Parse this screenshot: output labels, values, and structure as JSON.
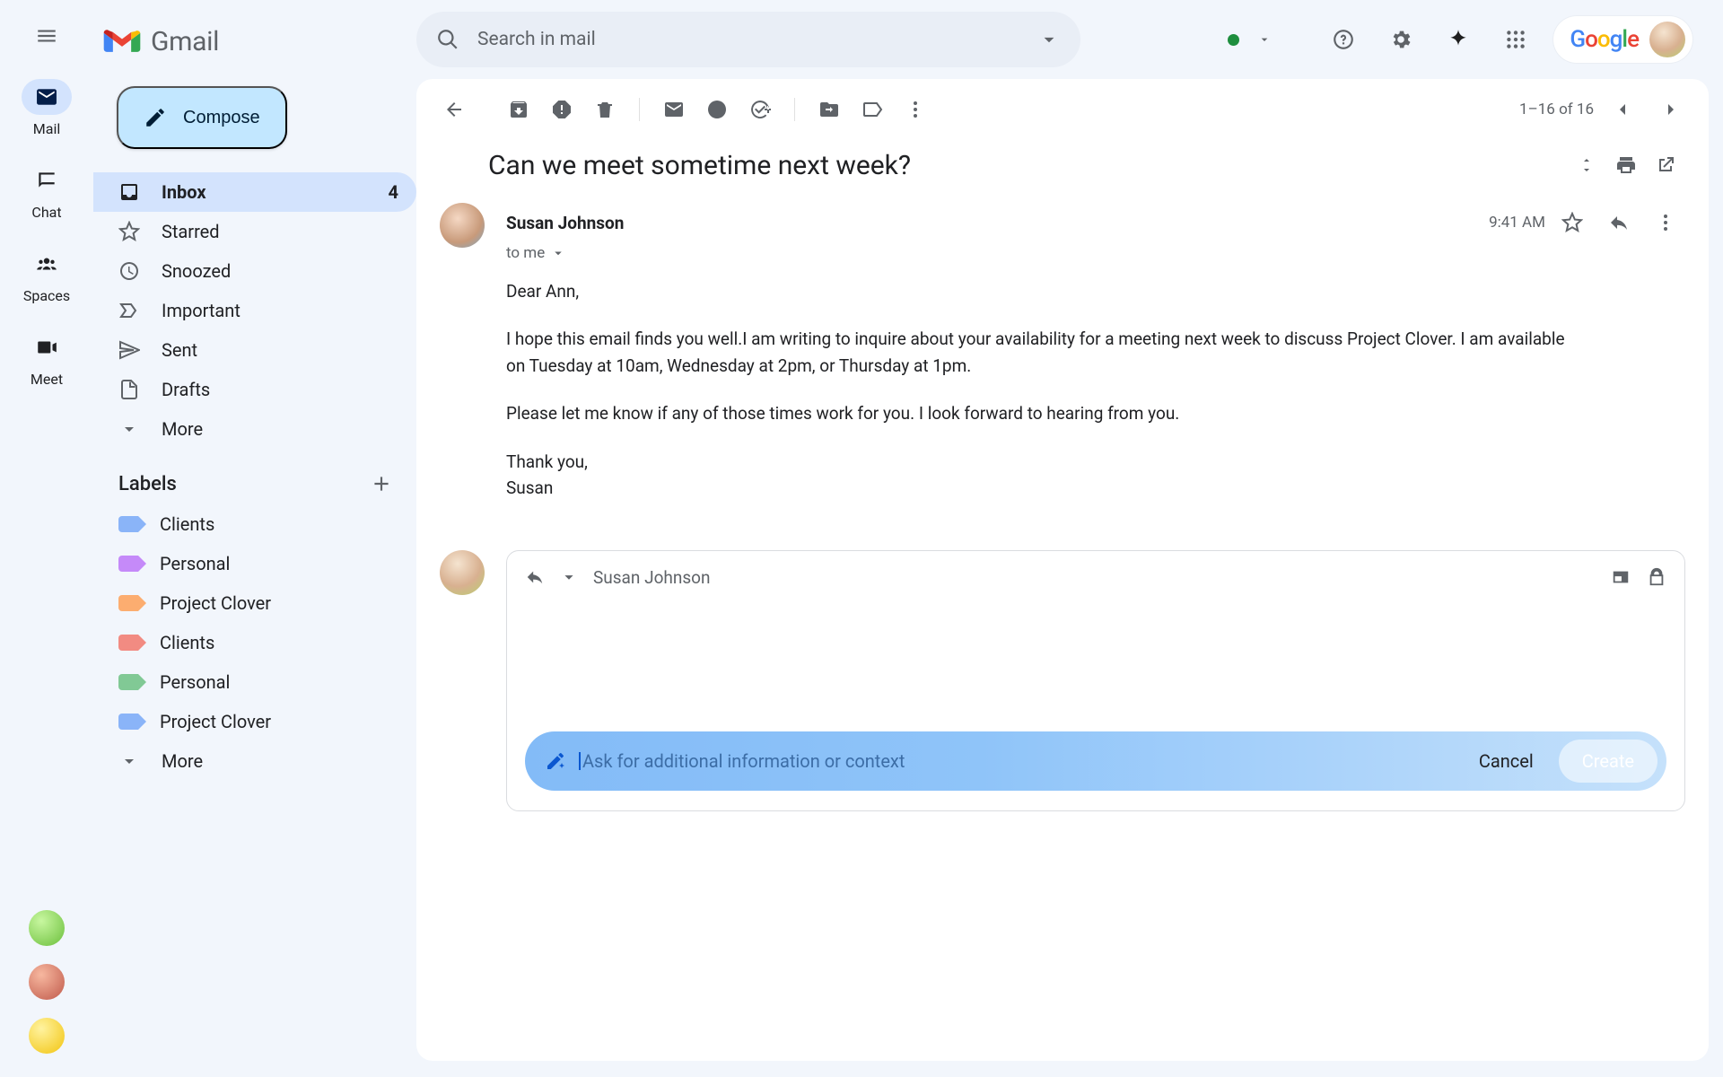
{
  "app": {
    "name": "Gmail"
  },
  "rail": {
    "items": [
      {
        "id": "mail",
        "label": "Mail",
        "active": true
      },
      {
        "id": "chat",
        "label": "Chat",
        "active": false
      },
      {
        "id": "spaces",
        "label": "Spaces",
        "active": false
      },
      {
        "id": "meet",
        "label": "Meet",
        "active": false
      }
    ]
  },
  "search": {
    "placeholder": "Search in mail"
  },
  "compose": {
    "label": "Compose"
  },
  "folders": [
    {
      "id": "inbox",
      "label": "Inbox",
      "count": "4",
      "selected": true
    },
    {
      "id": "starred",
      "label": "Starred"
    },
    {
      "id": "snoozed",
      "label": "Snoozed"
    },
    {
      "id": "important",
      "label": "Important"
    },
    {
      "id": "sent",
      "label": "Sent"
    },
    {
      "id": "drafts",
      "label": "Drafts"
    },
    {
      "id": "more",
      "label": "More"
    }
  ],
  "labels_header": "Labels",
  "labels": [
    {
      "label": "Clients",
      "color": "#8ab4f8"
    },
    {
      "label": "Personal",
      "color": "#c58af9"
    },
    {
      "label": "Project Clover",
      "color": "#fcad70"
    },
    {
      "label": "Clients",
      "color": "#f28b82"
    },
    {
      "label": "Personal",
      "color": "#81c995"
    },
    {
      "label": "Project Clover",
      "color": "#8ab4f8"
    },
    {
      "label": "More",
      "color": ""
    }
  ],
  "pager": {
    "range": "1–16 of 16"
  },
  "thread": {
    "subject": "Can we meet sometime next week?",
    "sender_name": "Susan Johnson",
    "recipient": "to me",
    "timestamp": "9:41 AM",
    "paragraphs": [
      "Dear Ann,",
      "I hope this email finds you well.I am writing to inquire about your availability for a meeting next week to discuss Project Clover. I am available on Tuesday at 10am, Wednesday at 2pm, or Thursday at 1pm.",
      "Please let me know if any of those times work for you. I look forward to hearing from you.",
      "Thank you,\nSusan"
    ]
  },
  "reply": {
    "to": "Susan Johnson",
    "ai_prompt_placeholder": "Ask for additional information or context",
    "cancel": "Cancel",
    "create": "Create"
  },
  "google_word": "Google"
}
